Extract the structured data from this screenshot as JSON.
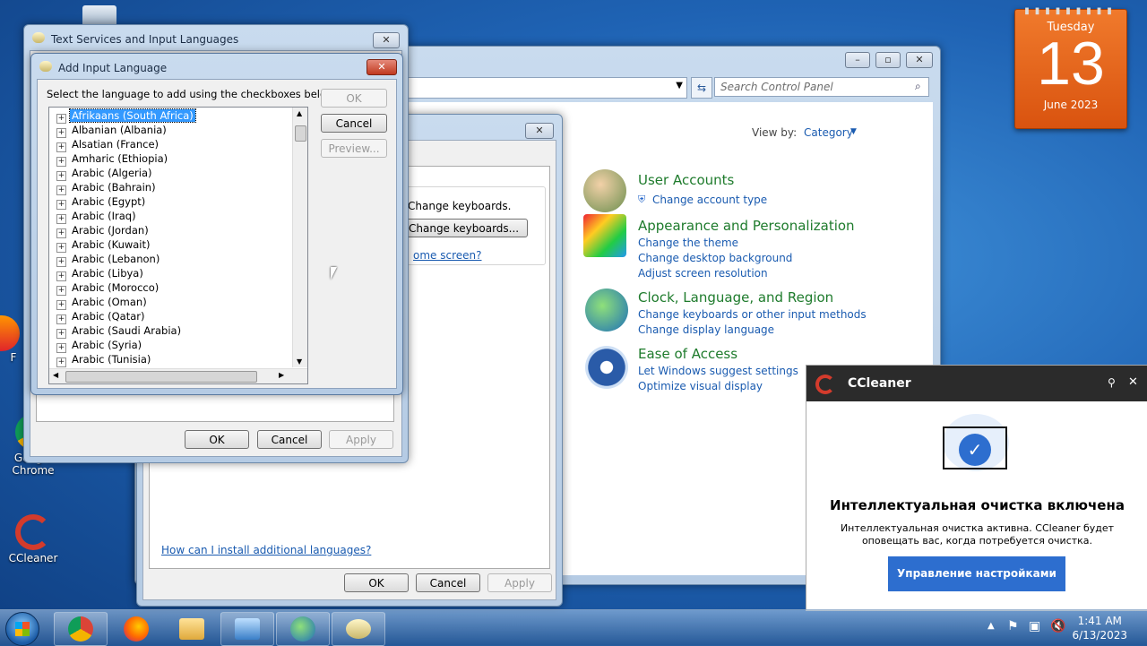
{
  "desktop": {
    "icons": [
      {
        "label": "Google Chrome"
      },
      {
        "label": "CCleaner"
      }
    ],
    "partial_icon_letter": "F"
  },
  "calendar": {
    "weekday": "Tuesday",
    "day": "13",
    "month_year": "June 2023"
  },
  "control_panel": {
    "search_placeholder": "Search Control Panel",
    "view_by_label": "View by:",
    "view_by_value": "Category",
    "categories": [
      {
        "title": "User Accounts",
        "links": [
          "Change account type"
        ]
      },
      {
        "title": "Appearance and Personalization",
        "links": [
          "Change the theme",
          "Change desktop background",
          "Adjust screen resolution"
        ]
      },
      {
        "title": "Clock, Language, and Region",
        "links": [
          "Change keyboards or other input methods",
          "Change display language"
        ]
      },
      {
        "title": "Ease of Access",
        "links": [
          "Let Windows suggest settings",
          "Optimize visual display"
        ]
      }
    ]
  },
  "region_dialog": {
    "change_keyboards_text": "Change keyboards.",
    "change_keyboards_button": "Change keyboards...",
    "welcome_link_partial": "ome screen?",
    "install_languages_link": "How can I install additional languages?",
    "ok": "OK",
    "cancel": "Cancel",
    "apply": "Apply"
  },
  "text_services": {
    "title": "Text Services and Input Languages",
    "ok": "OK",
    "cancel": "Cancel",
    "apply": "Apply"
  },
  "add_language": {
    "title": "Add Input Language",
    "instruction": "Select the language to add using the checkboxes below.",
    "ok": "OK",
    "cancel": "Cancel",
    "preview": "Preview...",
    "languages": [
      "Afrikaans (South Africa)",
      "Albanian (Albania)",
      "Alsatian (France)",
      "Amharic (Ethiopia)",
      "Arabic (Algeria)",
      "Arabic (Bahrain)",
      "Arabic (Egypt)",
      "Arabic (Iraq)",
      "Arabic (Jordan)",
      "Arabic (Kuwait)",
      "Arabic (Lebanon)",
      "Arabic (Libya)",
      "Arabic (Morocco)",
      "Arabic (Oman)",
      "Arabic (Qatar)",
      "Arabic (Saudi Arabia)",
      "Arabic (Syria)",
      "Arabic (Tunisia)"
    ]
  },
  "ccleaner": {
    "app_name": "CCleaner",
    "headline": "Интеллектуальная очистка включена",
    "body": "Интеллектуальная очистка активна. CCleaner будет оповещать вас, когда потребуется очистка.",
    "button": "Управление настройками"
  },
  "taskbar": {
    "time": "1:41 AM",
    "date": "6/13/2023"
  },
  "colors": {
    "accent_blue": "#2d6ecf",
    "category_green": "#1e7b2c",
    "link_blue": "#1a5bb0",
    "calendar_orange": "#e8641c"
  }
}
